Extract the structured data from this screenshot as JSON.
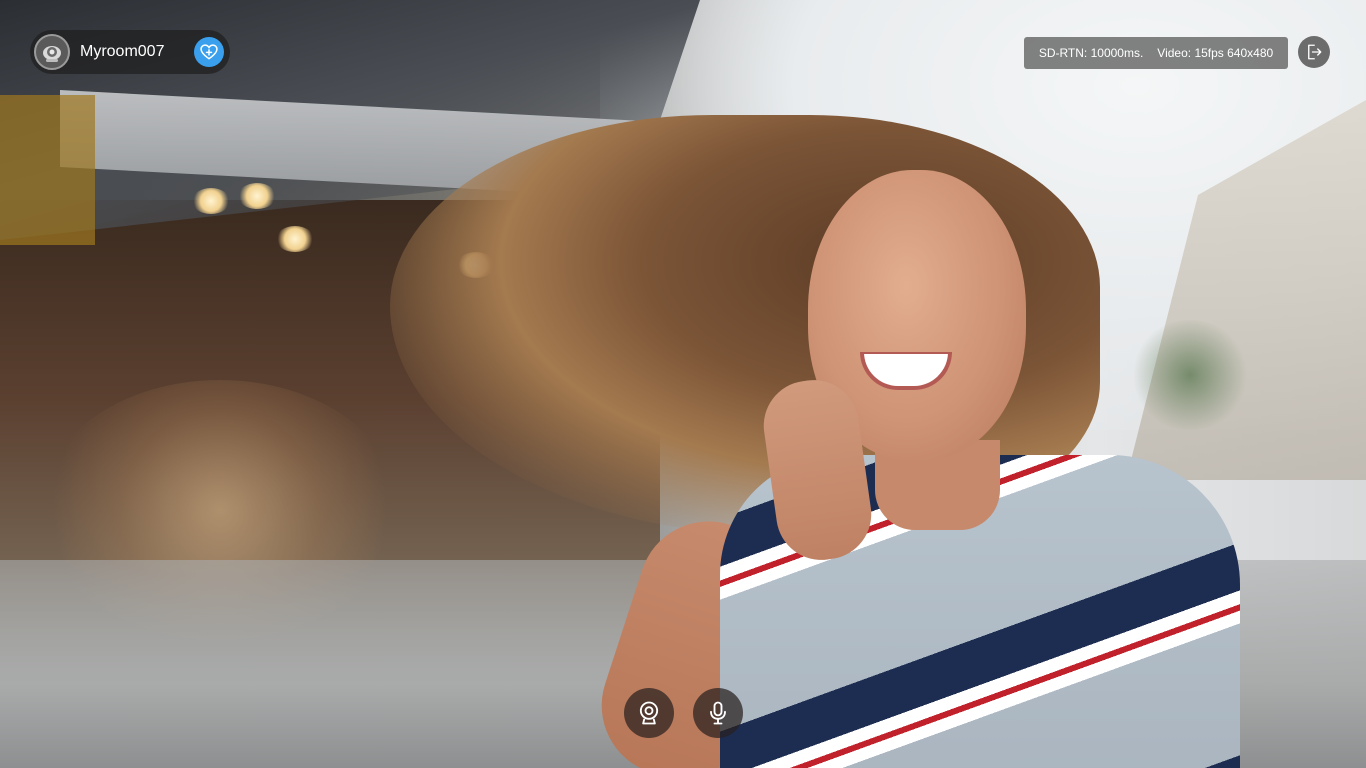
{
  "header": {
    "room_name": "Myroom007",
    "avatar_icon": "camera-avatar-icon",
    "favorite_icon": "heart-plus-icon",
    "favorite_color": "#3aa0ee"
  },
  "stats": {
    "network": "SD-RTN: 10000ms.",
    "video": "Video: 15fps 640x480"
  },
  "actions": {
    "exit_icon": "exit-icon"
  },
  "controls": {
    "camera_icon": "webcam-icon",
    "mic_icon": "microphone-icon"
  }
}
